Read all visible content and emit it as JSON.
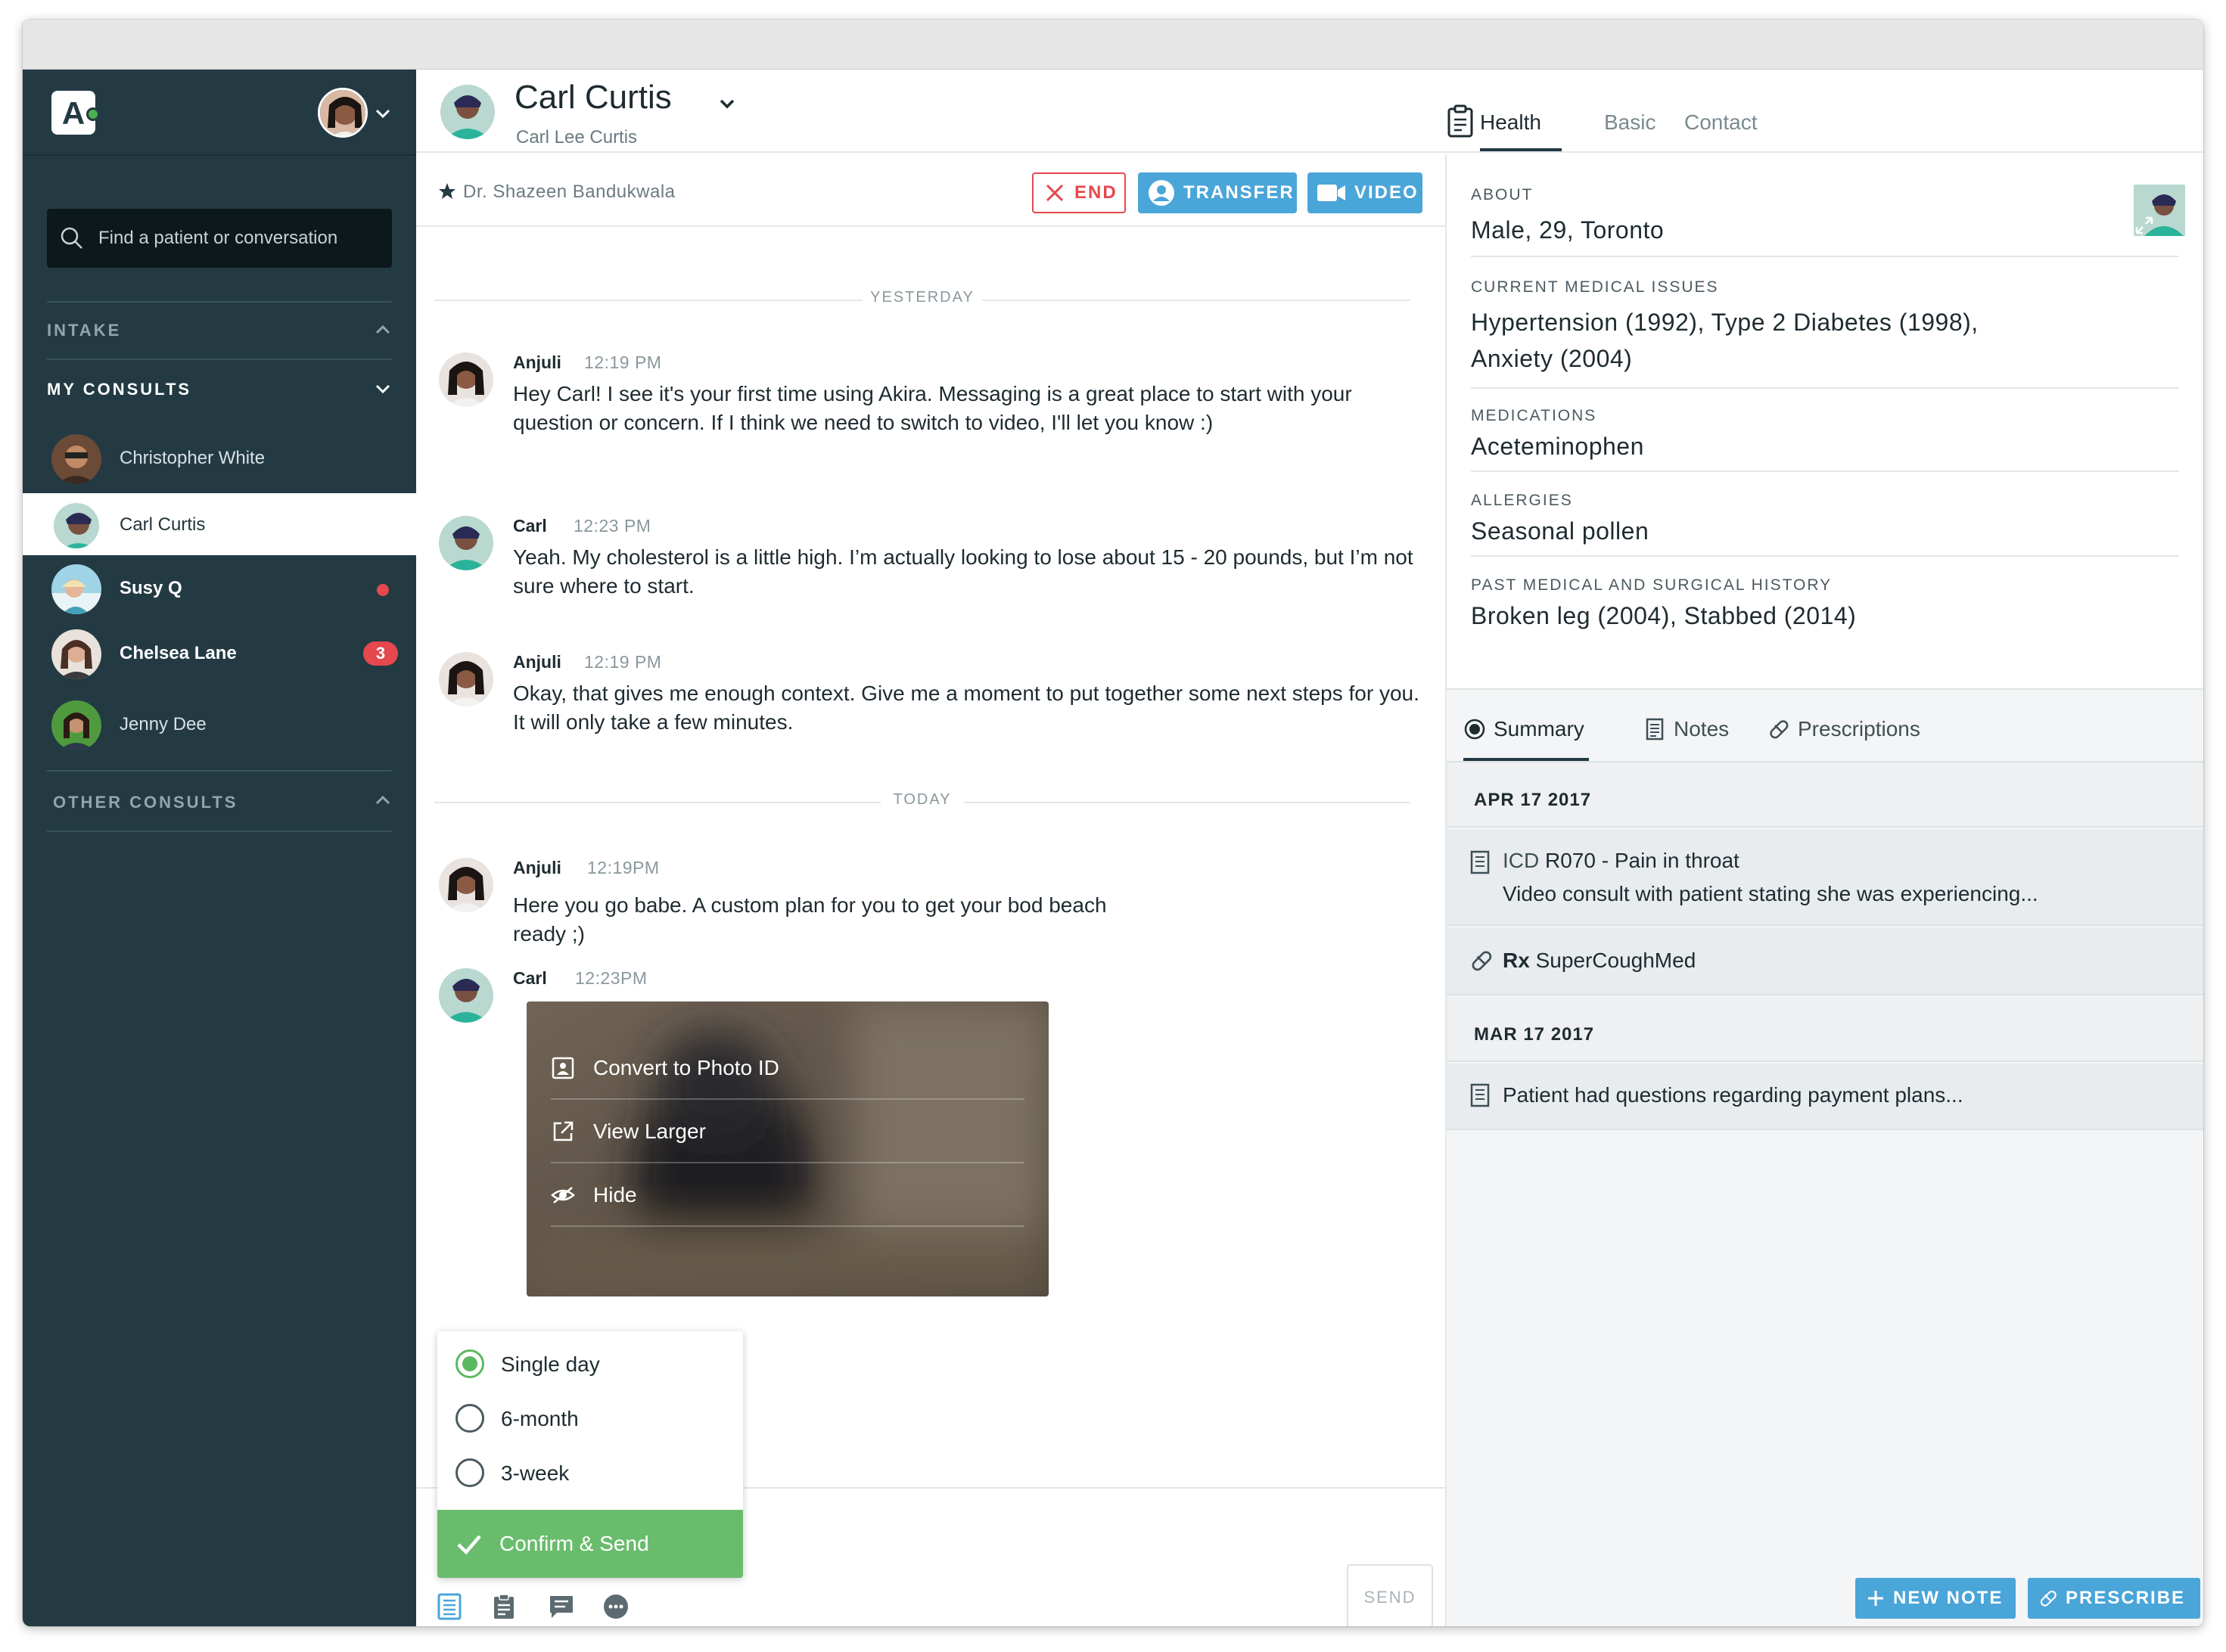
{
  "sidebar": {
    "logo_letter": "A",
    "search_placeholder": "Find a patient or conversation",
    "sections": {
      "intake": "INTAKE",
      "my_consults": "MY CONSULTS",
      "other_consults": "OTHER CONSULTS"
    },
    "consults": [
      {
        "name": "Christopher White",
        "bold": false,
        "active": false
      },
      {
        "name": "Carl Curtis",
        "bold": false,
        "active": true
      },
      {
        "name": "Susy Q",
        "bold": true,
        "active": false,
        "unread_dot": true
      },
      {
        "name": "Chelsea Lane",
        "bold": true,
        "active": false,
        "badge": "3"
      },
      {
        "name": "Jenny Dee",
        "bold": false,
        "active": false
      }
    ]
  },
  "header": {
    "patient_name": "Carl Curtis",
    "patient_full_name": "Carl Lee Curtis",
    "tabs": [
      "Health",
      "Basic",
      "Contact"
    ],
    "active_tab": "Health"
  },
  "chat": {
    "doctor": "Dr. Shazeen Bandukwala",
    "buttons": {
      "end": "END",
      "transfer": "TRANSFER",
      "video": "VIDEO"
    },
    "separators": {
      "yesterday": "YESTERDAY",
      "today": "TODAY"
    },
    "messages": [
      {
        "author": "Anjuli",
        "time": "12:19 PM",
        "text": "Hey Carl! I see it's your first time using Akira. Messaging is a great place to start with your question or concern. If I think we need to switch to video, I'll let you know :)"
      },
      {
        "author": "Carl",
        "time": "12:23 PM",
        "text": "Yeah. My cholesterol is a little high. I’m actually looking to lose about 15 - 20 pounds, but I’m not sure where to start."
      },
      {
        "author": "Anjuli",
        "time": "12:19 PM",
        "text": "Okay, that gives me enough context. Give me a moment to put together some next steps for you. It will only take a few minutes."
      },
      {
        "author": "Anjuli",
        "time": "12:19PM",
        "text": "Here you go babe. A custom plan for you to get your bod beach ready ;)"
      },
      {
        "author": "Carl",
        "time": "12:23PM",
        "text": ""
      }
    ],
    "photo_menu": [
      "Convert to Photo ID",
      "View Larger",
      "Hide"
    ],
    "plan_options": [
      {
        "label": "Single day",
        "selected": true
      },
      {
        "label": "6-month",
        "selected": false
      },
      {
        "label": "3-week",
        "selected": false
      }
    ],
    "confirm_label": "Confirm & Send",
    "send_label": "SEND"
  },
  "health": {
    "about_label": "ABOUT",
    "about_value": "Male, 29, Toronto",
    "issues_label": "CURRENT MEDICAL ISSUES",
    "issues_value": "Hypertension (1992), Type 2 Diabetes (1998), Anxiety (2004)",
    "medications_label": "MEDICATIONS",
    "medications_value": "Aceteminophen",
    "allergies_label": "ALLERGIES",
    "allergies_value": "Seasonal pollen",
    "history_label": "PAST MEDICAL AND SURGICAL HISTORY",
    "history_value": "Broken leg (2004), Stabbed (2014)"
  },
  "records": {
    "tabs": [
      "Summary",
      "Notes",
      "Prescriptions"
    ],
    "active_tab": "Summary",
    "groups": [
      {
        "date": "APR 17 2017",
        "icd_prefix": "ICD",
        "icd_code": "R070 - Pain in throat",
        "note": "Video consult with patient stating she was experiencing...",
        "rx_prefix": "Rx",
        "rx_name": "SuperCoughMed"
      },
      {
        "date": "MAR 17 2017",
        "note": "Patient had questions regarding payment plans..."
      }
    ],
    "new_note_label": "NEW NOTE",
    "prescribe_label": "PRESCRIBE"
  },
  "colors": {
    "sidebar_bg": "#233a43",
    "accent_blue": "#4aa5d8",
    "danger_red": "#e5484d",
    "success_green": "#6abc6d"
  },
  "icons": [
    "search-icon",
    "chevron-down-icon",
    "chevron-up-icon",
    "star-icon",
    "close-icon",
    "user-icon",
    "video-camera-icon",
    "clipboard-icon",
    "id-card-icon",
    "external-link-icon",
    "eye-off-icon",
    "check-icon",
    "document-icon",
    "pill-icon",
    "plus-icon",
    "chat-icon",
    "more-icon",
    "expand-icon"
  ]
}
